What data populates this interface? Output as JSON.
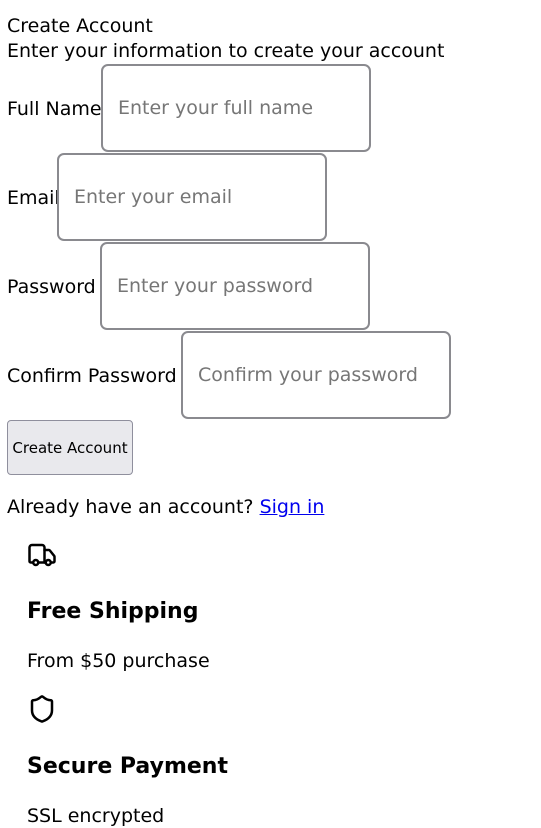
{
  "header": {
    "title": "Create Account",
    "subtitle": "Enter your information to create your account"
  },
  "form": {
    "full_name": {
      "label": "Full Name",
      "placeholder": "Enter your full name",
      "value": ""
    },
    "email": {
      "label": "Email",
      "placeholder": "Enter your email",
      "value": ""
    },
    "password": {
      "label": "Password",
      "placeholder": "Enter your password",
      "value": ""
    },
    "confirm_password": {
      "label": "Confirm Password",
      "placeholder": "Confirm your password",
      "value": ""
    },
    "submit_label": "Create Account"
  },
  "signin": {
    "prompt": "Already have an account?",
    "link_label": "Sign in"
  },
  "features": [
    {
      "icon": "truck-icon",
      "title": "Free Shipping",
      "description": "From $50 purchase"
    },
    {
      "icon": "shield-icon",
      "title": "Secure Payment",
      "description": "SSL encrypted"
    }
  ]
}
